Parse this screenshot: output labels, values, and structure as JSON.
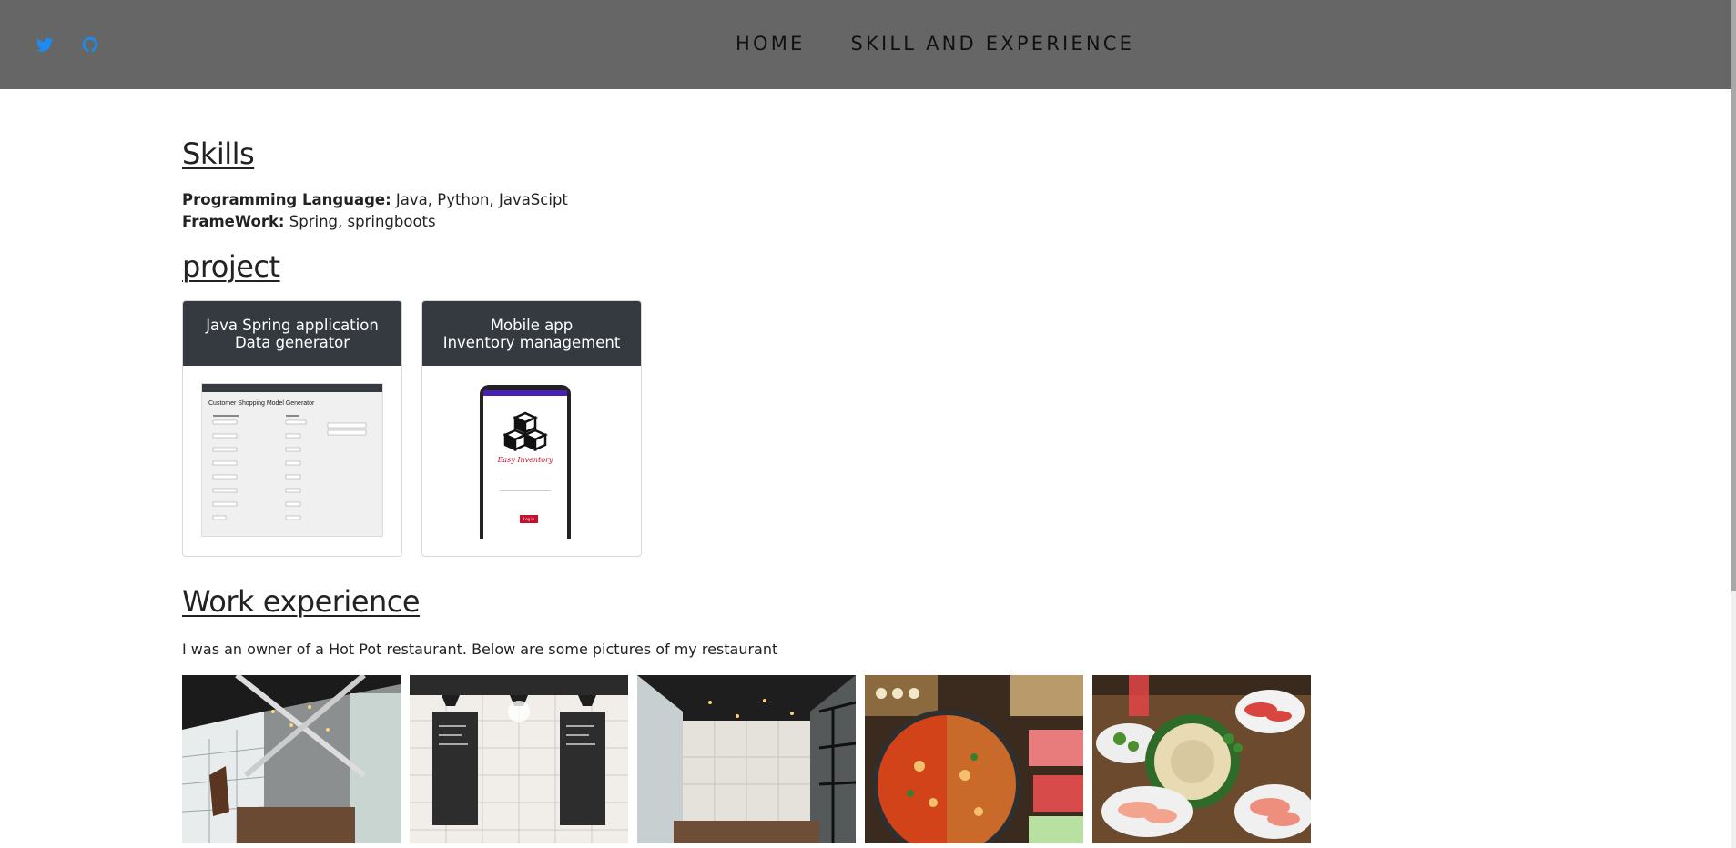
{
  "nav": {
    "social": [
      "twitter-icon",
      "github-icon"
    ],
    "links": [
      "HOME",
      "SKILL AND EXPERIENCE"
    ]
  },
  "skills": {
    "title": "Skills",
    "programming_label": "Programming Language:",
    "programming_value": " Java, Python, JavaScipt",
    "framework_label": "FrameWork:",
    "framework_value": " Spring, springboots"
  },
  "project": {
    "title": "project",
    "cards": [
      {
        "line1": "Java Spring application",
        "line2": "Data generator",
        "screenshot_title": "Customer Shopping Model Generator"
      },
      {
        "line1": "Mobile app",
        "line2": "Inventory management",
        "app_name": "Easy Inventory",
        "login_label": "Log in"
      }
    ]
  },
  "work": {
    "title": "Work experience",
    "description": "I was an owner of a Hot Pot restaurant. Below are some pictures of my restaurant",
    "photos": [
      "restaurant-interior-photo",
      "restaurant-menu-wall-photo",
      "restaurant-dining-hall-photo",
      "hotpot-dishes-photo",
      "hotpot-table-photo"
    ]
  },
  "colors": {
    "navbar": "#666666",
    "card_header": "#343a40",
    "accent_icon": "#1da1f2"
  }
}
